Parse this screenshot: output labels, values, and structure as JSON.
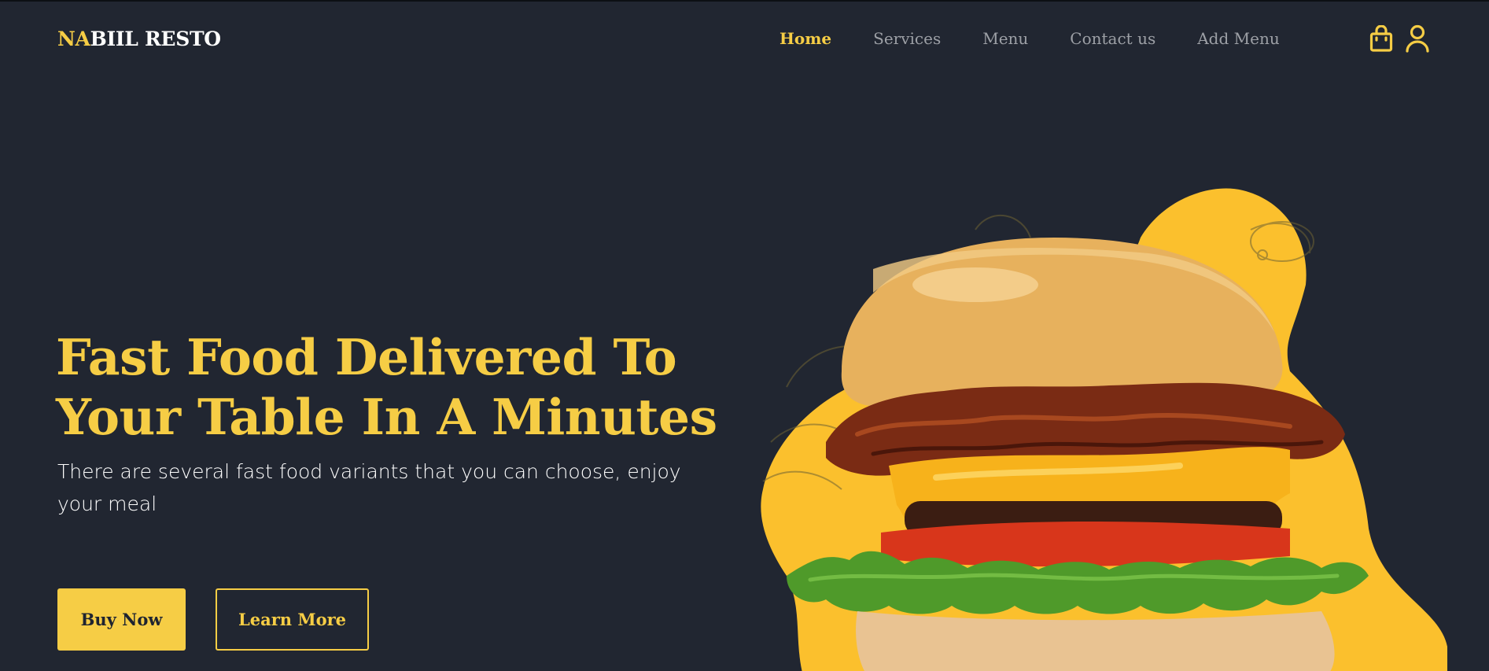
{
  "brand": {
    "accent": "NA",
    "rest": "BIIL RESTO"
  },
  "nav": {
    "items": [
      {
        "label": "Home",
        "active": true
      },
      {
        "label": "Services",
        "active": false
      },
      {
        "label": "Menu",
        "active": false
      },
      {
        "label": "Contact us",
        "active": false
      },
      {
        "label": "Add Menu",
        "active": false
      }
    ],
    "icons": [
      "shopping-bag-icon",
      "user-icon"
    ]
  },
  "hero": {
    "title": "Fast Food Delivered To Your Table In A Minutes",
    "subtitle": "There are several fast food variants that you can choose, enjoy your meal",
    "buy_label": "Buy Now",
    "learn_label": "Learn More",
    "image": "burger-image"
  },
  "colors": {
    "background": "#212631",
    "accent": "#f6cd45",
    "text_muted": "#9da0a6",
    "text_light": "#ffffff",
    "blob": "#fbc02d"
  }
}
